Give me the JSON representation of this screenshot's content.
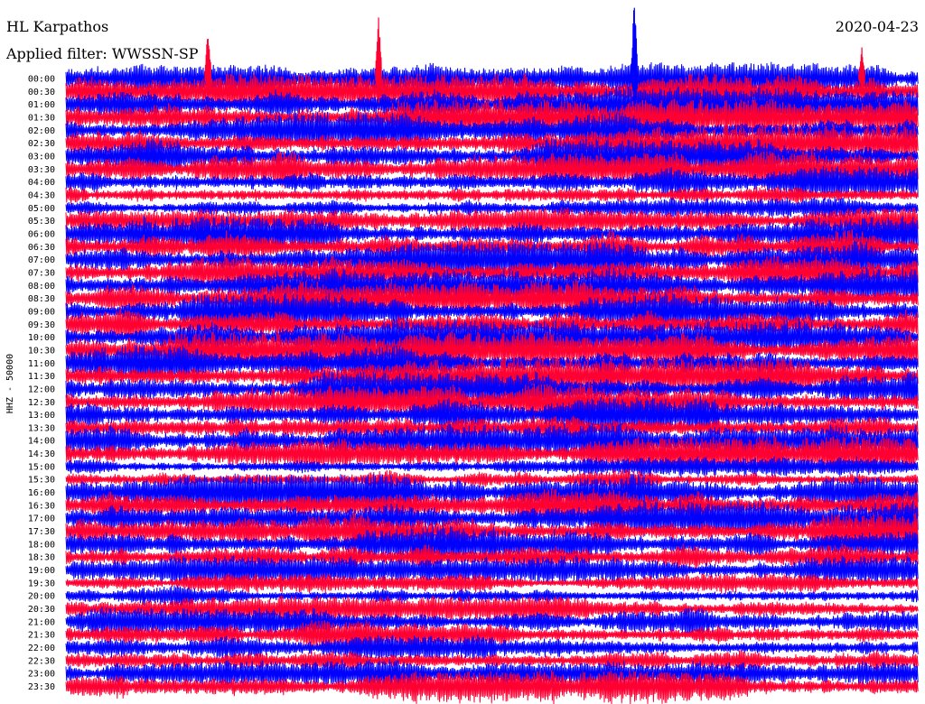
{
  "header": {
    "station": "HL Karpathos",
    "filter": "Applied filter: WWSSN-SP",
    "date": "2020-04-23"
  },
  "chart_data": {
    "type": "line",
    "title": "HL Karpathos",
    "subtitle": "Applied filter: WWSSN-SP",
    "date": "2020-04-23",
    "ylabel": "HHZ - 50000",
    "xlabel": "",
    "row_interval_minutes": 30,
    "trace_colors": [
      "#0000ff",
      "#ff0033"
    ],
    "grid": false,
    "legend": "none",
    "y_tick_labels": [
      "00:00",
      "00:30",
      "01:00",
      "01:30",
      "02:00",
      "02:30",
      "03:00",
      "03:30",
      "04:00",
      "04:30",
      "05:00",
      "05:30",
      "06:00",
      "06:30",
      "07:00",
      "07:30",
      "08:00",
      "08:30",
      "09:00",
      "09:30",
      "10:00",
      "10:30",
      "11:00",
      "11:30",
      "12:00",
      "12:30",
      "13:00",
      "13:30",
      "14:00",
      "14:30",
      "15:00",
      "15:30",
      "16:00",
      "16:30",
      "17:00",
      "17:30",
      "18:00",
      "18:30",
      "19:00",
      "19:30",
      "20:00",
      "20:30",
      "21:00",
      "21:30",
      "22:00",
      "22:30",
      "23:00",
      "23:30"
    ],
    "rows": [
      {
        "time": "00:00",
        "color": "blue",
        "amplitude": 0.9
      },
      {
        "time": "00:30",
        "color": "red",
        "amplitude": 1.0
      },
      {
        "time": "01:00",
        "color": "blue",
        "amplitude": 1.0
      },
      {
        "time": "01:30",
        "color": "red",
        "amplitude": 1.0
      },
      {
        "time": "02:00",
        "color": "blue",
        "amplitude": 1.0
      },
      {
        "time": "02:30",
        "color": "red",
        "amplitude": 1.0
      },
      {
        "time": "03:00",
        "color": "blue",
        "amplitude": 1.0
      },
      {
        "time": "03:30",
        "color": "red",
        "amplitude": 1.0
      },
      {
        "time": "04:00",
        "color": "blue",
        "amplitude": 0.9
      },
      {
        "time": "04:30",
        "color": "red",
        "amplitude": 0.7
      },
      {
        "time": "05:00",
        "color": "blue",
        "amplitude": 0.6
      },
      {
        "time": "05:30",
        "color": "red",
        "amplitude": 0.8
      },
      {
        "time": "06:00",
        "color": "blue",
        "amplitude": 1.0
      },
      {
        "time": "06:30",
        "color": "red",
        "amplitude": 1.0
      },
      {
        "time": "07:00",
        "color": "blue",
        "amplitude": 1.0
      },
      {
        "time": "07:30",
        "color": "red",
        "amplitude": 1.0
      },
      {
        "time": "08:00",
        "color": "blue",
        "amplitude": 1.0
      },
      {
        "time": "08:30",
        "color": "red",
        "amplitude": 1.0
      },
      {
        "time": "09:00",
        "color": "blue",
        "amplitude": 1.0
      },
      {
        "time": "09:30",
        "color": "red",
        "amplitude": 1.0
      },
      {
        "time": "10:00",
        "color": "blue",
        "amplitude": 1.0
      },
      {
        "time": "10:30",
        "color": "red",
        "amplitude": 1.0
      },
      {
        "time": "11:00",
        "color": "blue",
        "amplitude": 1.0
      },
      {
        "time": "11:30",
        "color": "red",
        "amplitude": 1.0
      },
      {
        "time": "12:00",
        "color": "blue",
        "amplitude": 1.0
      },
      {
        "time": "12:30",
        "color": "red",
        "amplitude": 1.0
      },
      {
        "time": "13:00",
        "color": "blue",
        "amplitude": 1.0
      },
      {
        "time": "13:30",
        "color": "red",
        "amplitude": 1.0
      },
      {
        "time": "14:00",
        "color": "blue",
        "amplitude": 1.0
      },
      {
        "time": "14:30",
        "color": "red",
        "amplitude": 1.0
      },
      {
        "time": "15:00",
        "color": "blue",
        "amplitude": 0.55
      },
      {
        "time": "15:30",
        "color": "red",
        "amplitude": 0.6
      },
      {
        "time": "16:00",
        "color": "blue",
        "amplitude": 1.0
      },
      {
        "time": "16:30",
        "color": "red",
        "amplitude": 1.0
      },
      {
        "time": "17:00",
        "color": "blue",
        "amplitude": 1.0
      },
      {
        "time": "17:30",
        "color": "red",
        "amplitude": 1.0
      },
      {
        "time": "18:00",
        "color": "blue",
        "amplitude": 1.0
      },
      {
        "time": "18:30",
        "color": "red",
        "amplitude": 0.9
      },
      {
        "time": "19:00",
        "color": "blue",
        "amplitude": 0.8
      },
      {
        "time": "19:30",
        "color": "red",
        "amplitude": 0.5
      },
      {
        "time": "20:00",
        "color": "blue",
        "amplitude": 0.6
      },
      {
        "time": "20:30",
        "color": "red",
        "amplitude": 0.7
      },
      {
        "time": "21:00",
        "color": "blue",
        "amplitude": 0.8
      },
      {
        "time": "21:30",
        "color": "red",
        "amplitude": 0.8
      },
      {
        "time": "22:00",
        "color": "blue",
        "amplitude": 0.7
      },
      {
        "time": "22:30",
        "color": "red",
        "amplitude": 0.8
      },
      {
        "time": "23:00",
        "color": "blue",
        "amplitude": 0.8
      },
      {
        "time": "23:30",
        "color": "red",
        "amplitude": 0.9
      }
    ],
    "events": [
      {
        "time": "00:00",
        "minute": 5,
        "amplitude_rows": 4.0,
        "color": "red"
      },
      {
        "time": "00:00",
        "minute": 11,
        "amplitude_rows": 5.0,
        "color": "red"
      },
      {
        "time": "00:00",
        "minute": 20,
        "amplitude_rows": 6.5,
        "color": "blue"
      },
      {
        "time": "00:00",
        "minute": 28,
        "amplitude_rows": 2.5,
        "color": "red"
      }
    ]
  }
}
